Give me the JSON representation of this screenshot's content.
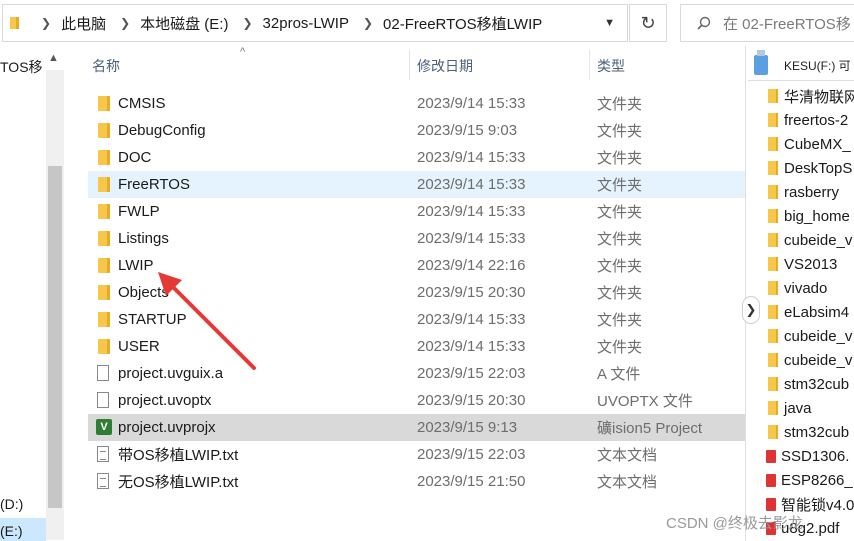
{
  "address_bar": {
    "crumbs": [
      "此电脑",
      "本地磁盘 (E:)",
      "32pros-LWIP",
      "02-FreeRTOS移植LWIP"
    ]
  },
  "search": {
    "placeholder": "在 02-FreeRTOS移"
  },
  "nav": {
    "top_label": "TOS移",
    "drive_d": "(D:)",
    "drive_e": "(E:)"
  },
  "columns": {
    "name": "名称",
    "date": "修改日期",
    "type": "类型"
  },
  "files": [
    {
      "name": "CMSIS",
      "date": "2023/9/14 15:33",
      "type": "文件夹",
      "kind": "folder"
    },
    {
      "name": "DebugConfig",
      "date": "2023/9/15 9:03",
      "type": "文件夹",
      "kind": "folder"
    },
    {
      "name": "DOC",
      "date": "2023/9/14 15:33",
      "type": "文件夹",
      "kind": "folder"
    },
    {
      "name": "FreeRTOS",
      "date": "2023/9/14 15:33",
      "type": "文件夹",
      "kind": "folder",
      "state": "hover"
    },
    {
      "name": "FWLP",
      "date": "2023/9/14 15:33",
      "type": "文件夹",
      "kind": "folder"
    },
    {
      "name": "Listings",
      "date": "2023/9/14 15:33",
      "type": "文件夹",
      "kind": "folder"
    },
    {
      "name": "LWIP",
      "date": "2023/9/14 22:16",
      "type": "文件夹",
      "kind": "folder"
    },
    {
      "name": "Objects",
      "date": "2023/9/15 20:30",
      "type": "文件夹",
      "kind": "folder"
    },
    {
      "name": "STARTUP",
      "date": "2023/9/14 15:33",
      "type": "文件夹",
      "kind": "folder"
    },
    {
      "name": "USER",
      "date": "2023/9/14 15:33",
      "type": "文件夹",
      "kind": "folder"
    },
    {
      "name": "project.uvguix.a",
      "date": "2023/9/15 22:03",
      "type": "A 文件",
      "kind": "file"
    },
    {
      "name": "project.uvoptx",
      "date": "2023/9/15 20:30",
      "type": "UVOPTX 文件",
      "kind": "file"
    },
    {
      "name": "project.uvprojx",
      "date": "2023/9/15 9:13",
      "type": "礦ision5 Project",
      "kind": "uvproj",
      "state": "selected"
    },
    {
      "name": "带OS移植LWIP.txt",
      "date": "2023/9/15 22:03",
      "type": "文本文档",
      "kind": "txt"
    },
    {
      "name": "无OS移植LWIP.txt",
      "date": "2023/9/15 21:50",
      "type": "文本文档",
      "kind": "txt"
    }
  ],
  "side_panel": {
    "drive": "KESU(F:) 可",
    "items": [
      {
        "name": "华清物联网",
        "kind": "folder"
      },
      {
        "name": "freertos-2",
        "kind": "folder"
      },
      {
        "name": "CubeMX_",
        "kind": "folder"
      },
      {
        "name": "DeskTopS",
        "kind": "folder"
      },
      {
        "name": "rasberry",
        "kind": "folder"
      },
      {
        "name": "big_home",
        "kind": "folder"
      },
      {
        "name": "cubeide_v",
        "kind": "folder"
      },
      {
        "name": "VS2013",
        "kind": "folder"
      },
      {
        "name": "vivado",
        "kind": "folder"
      },
      {
        "name": "eLabsim4",
        "kind": "folder"
      },
      {
        "name": "cubeide_v",
        "kind": "folder"
      },
      {
        "name": "cubeide_v",
        "kind": "folder"
      },
      {
        "name": "stm32cub",
        "kind": "folder"
      },
      {
        "name": "java",
        "kind": "folder"
      },
      {
        "name": "stm32cub",
        "kind": "folder"
      },
      {
        "name": "SSD1306.",
        "kind": "pdf"
      },
      {
        "name": "ESP8266_",
        "kind": "pdf"
      },
      {
        "name": "智能锁v4.0",
        "kind": "pdf"
      },
      {
        "name": "u8g2.pdf",
        "kind": "pdf"
      }
    ]
  },
  "watermark": "CSDN @终极去影龙",
  "colors": {
    "hover_row": "#e5f3ff",
    "selected_row": "#d9d9d9",
    "annotation_arrow": "#e53935",
    "folder": "#f7c74b"
  }
}
